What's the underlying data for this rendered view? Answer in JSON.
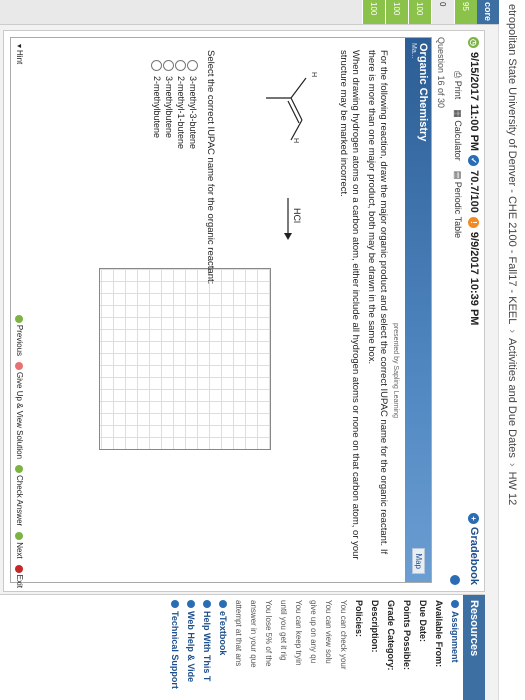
{
  "breadcrumb": [
    "etropolitan State University of Denver - CHE 2100 - Fall17 - KEEL",
    "Activities and Due Dates",
    "HW 12"
  ],
  "score_column": {
    "header": "core",
    "rows": [
      "95",
      "0",
      "100",
      "100",
      "100"
    ]
  },
  "dates": {
    "due": "9/15/2017 11:00 PM",
    "score": "70.7/100",
    "opened": "9/9/2017 10:39 PM"
  },
  "gradebook_label": "Gradebook",
  "tools": {
    "print": "Print",
    "calculator": "Calculator",
    "periodic": "Periodic Table"
  },
  "question_number": "Question 16 of 30",
  "question": {
    "title": "Organic Chemistry",
    "subtitle": "Ma...",
    "map_label": "Map",
    "presented_by": "presented by Sapling Learning",
    "instruction_1": "For the following reaction, draw the major organic product and select the correct IUPAC name for the organic reactant. If there is more than one major product, both may be drawn in the same box.",
    "instruction_2": "When drawing hydrogen atoms on a carbon atom, either include all hydrogen atoms or none on that carbon atom, or your structure may be marked incorrect.",
    "reagent": "HCl",
    "h_label": "H",
    "select_prompt": "Select the correct IUPAC name for the organic reactant:",
    "options": [
      "3-methyl-3-butene",
      "2-methyl-1-butene",
      "3-methylbutene",
      "2-methylbutene"
    ]
  },
  "bottom": {
    "hint": "Hint",
    "previous": "Previous",
    "give_up": "Give Up & View Solution",
    "check": "Check Answer",
    "next": "Next",
    "exit": "Exit"
  },
  "resources": {
    "header": "Resources",
    "assignment": "Assignment",
    "available_from": "Available From:",
    "due_date": "Due Date:",
    "points_possible": "Points Possible:",
    "grade_category": "Grade Category:",
    "description": "Description:",
    "policies": "Policies:",
    "policy_lines": [
      "You can check your",
      "You can view solu",
      "give up on any qu",
      "You can keep tryin",
      "until you get it rig",
      "You lose 5% of the",
      "answer in your que",
      "attempt at that ans"
    ],
    "etextbook": "eTextbook",
    "help_with_this": "Help With This T",
    "web_help": "Web Help & Vide",
    "tech_support": "Technical Support"
  }
}
